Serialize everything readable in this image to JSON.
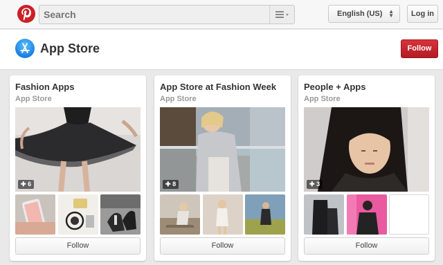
{
  "topbar": {
    "search": {
      "placeholder": "Search"
    },
    "language": {
      "selected": "English (US)"
    },
    "login_label": "Log in"
  },
  "header": {
    "title": "App Store",
    "follow_label": "Follow"
  },
  "boards": [
    {
      "title": "Fashion Apps",
      "owner": "App Store",
      "pin_count": "6",
      "follow_label": "Follow"
    },
    {
      "title": "App Store at Fashion Week",
      "owner": "App Store",
      "pin_count": "8",
      "follow_label": "Follow"
    },
    {
      "title": "People + Apps",
      "owner": "App Store",
      "pin_count": "3",
      "follow_label": "Follow"
    }
  ],
  "colors": {
    "brand_red": "#cb2027",
    "follow_red": "#bd2128",
    "app_store_blue": "#1a8cf0"
  },
  "icons": {
    "logo": "pinterest-logo-icon",
    "search_menu": "hamburger-menu-icon",
    "dropdown": "up-down-caret-icon",
    "app_store": "app-store-icon",
    "pin": "pin-icon"
  }
}
